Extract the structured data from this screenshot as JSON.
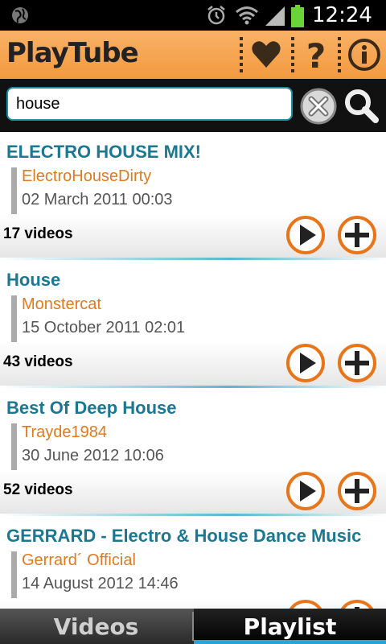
{
  "status_bar": {
    "time": "12:24"
  },
  "app_bar": {
    "title": "PlayTube"
  },
  "search": {
    "query": "house",
    "placeholder": ""
  },
  "playlists": [
    {
      "title": "ELECTRO HOUSE MIX!",
      "author": "ElectroHouseDirty",
      "date": "02 March 2011 00:03",
      "count": "17 videos"
    },
    {
      "title": "House",
      "author": "Monstercat",
      "date": "15 October 2011 02:01",
      "count": "43 videos"
    },
    {
      "title": "Best Of Deep House",
      "author": "Trayde1984",
      "date": "30 June 2012 10:06",
      "count": "52 videos"
    },
    {
      "title": "GERRARD - Electro & House Dance Music",
      "author": "Gerrard´ Official",
      "date": "14 August 2012 14:46",
      "count": ""
    }
  ],
  "bottom_nav": {
    "tabs": [
      "Videos",
      "Playlist"
    ],
    "active": "Playlist"
  },
  "colors": {
    "accent": "#f29a3f",
    "title_blue": "#1b7893",
    "author_orange": "#e07a1c",
    "tab_indicator": "#2ba3d6"
  },
  "icons": [
    "globe-icon",
    "alarm-icon",
    "wifi-icon",
    "signal-icon",
    "battery-icon",
    "heart-icon",
    "help-icon",
    "info-icon",
    "clear-icon",
    "search-icon",
    "play-icon",
    "add-icon"
  ]
}
